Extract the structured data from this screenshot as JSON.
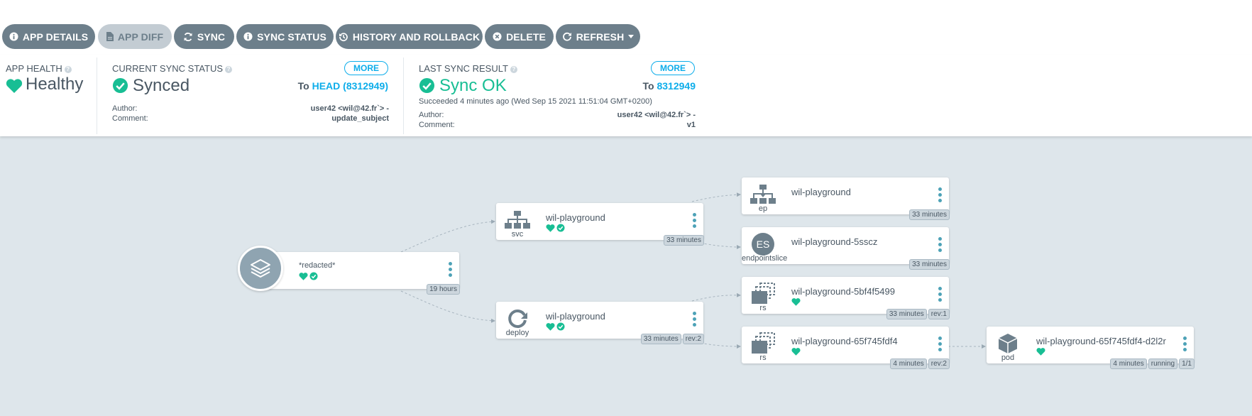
{
  "toolbar": {
    "app_details": "APP DETAILS",
    "app_diff": "APP DIFF",
    "sync": "SYNC",
    "sync_status": "SYNC STATUS",
    "history": "HISTORY AND ROLLBACK",
    "delete": "DELETE",
    "refresh": "REFRESH"
  },
  "health": {
    "label": "APP HEALTH",
    "value": "Healthy"
  },
  "current_sync": {
    "label": "CURRENT SYNC STATUS",
    "more": "MORE",
    "value": "Synced",
    "to_prefix": "To",
    "to_rev": "HEAD (8312949)",
    "author_label": "Author:",
    "author": "user42 <wil@42.fr`> -",
    "comment_label": "Comment:",
    "comment": "update_subject"
  },
  "last_sync": {
    "label": "LAST SYNC RESULT",
    "more": "MORE",
    "value": "Sync OK",
    "to_prefix": "To",
    "to_rev": "8312949",
    "succeeded": "Succeeded 4 minutes ago (Wed Sep 15 2021 11:51:04 GMT+0200)",
    "author_label": "Author:",
    "author": "user42 <wil@42.fr`> -",
    "comment_label": "Comment:",
    "comment": "v1"
  },
  "tree": {
    "app": {
      "name": "*redacted*",
      "age": "19 hours"
    },
    "svc": {
      "kind": "svc",
      "name": "wil-playground",
      "age": "33 minutes"
    },
    "deploy": {
      "kind": "deploy",
      "name": "wil-playground",
      "age": "33 minutes",
      "rev": "rev:2"
    },
    "ep": {
      "kind": "ep",
      "name": "wil-playground",
      "age": "33 minutes"
    },
    "eps": {
      "kind": "endpointslice",
      "badge": "ES",
      "name": "wil-playground-5sscz",
      "age": "33 minutes"
    },
    "rs1": {
      "kind": "rs",
      "name": "wil-playground-5bf4f5499",
      "age": "33 minutes",
      "rev": "rev:1"
    },
    "rs2": {
      "kind": "rs",
      "name": "wil-playground-65f745fdf4",
      "age": "4 minutes",
      "rev": "rev:2"
    },
    "pod": {
      "kind": "pod",
      "name": "wil-playground-65f745fdf4-d2l2r",
      "age": "4 minutes",
      "status": "running",
      "ready": "1/1"
    }
  },
  "colors": {
    "healthy": "#18be94",
    "link": "#0dadea",
    "button": "#6d7f8b",
    "canvas": "#dee6eb"
  }
}
